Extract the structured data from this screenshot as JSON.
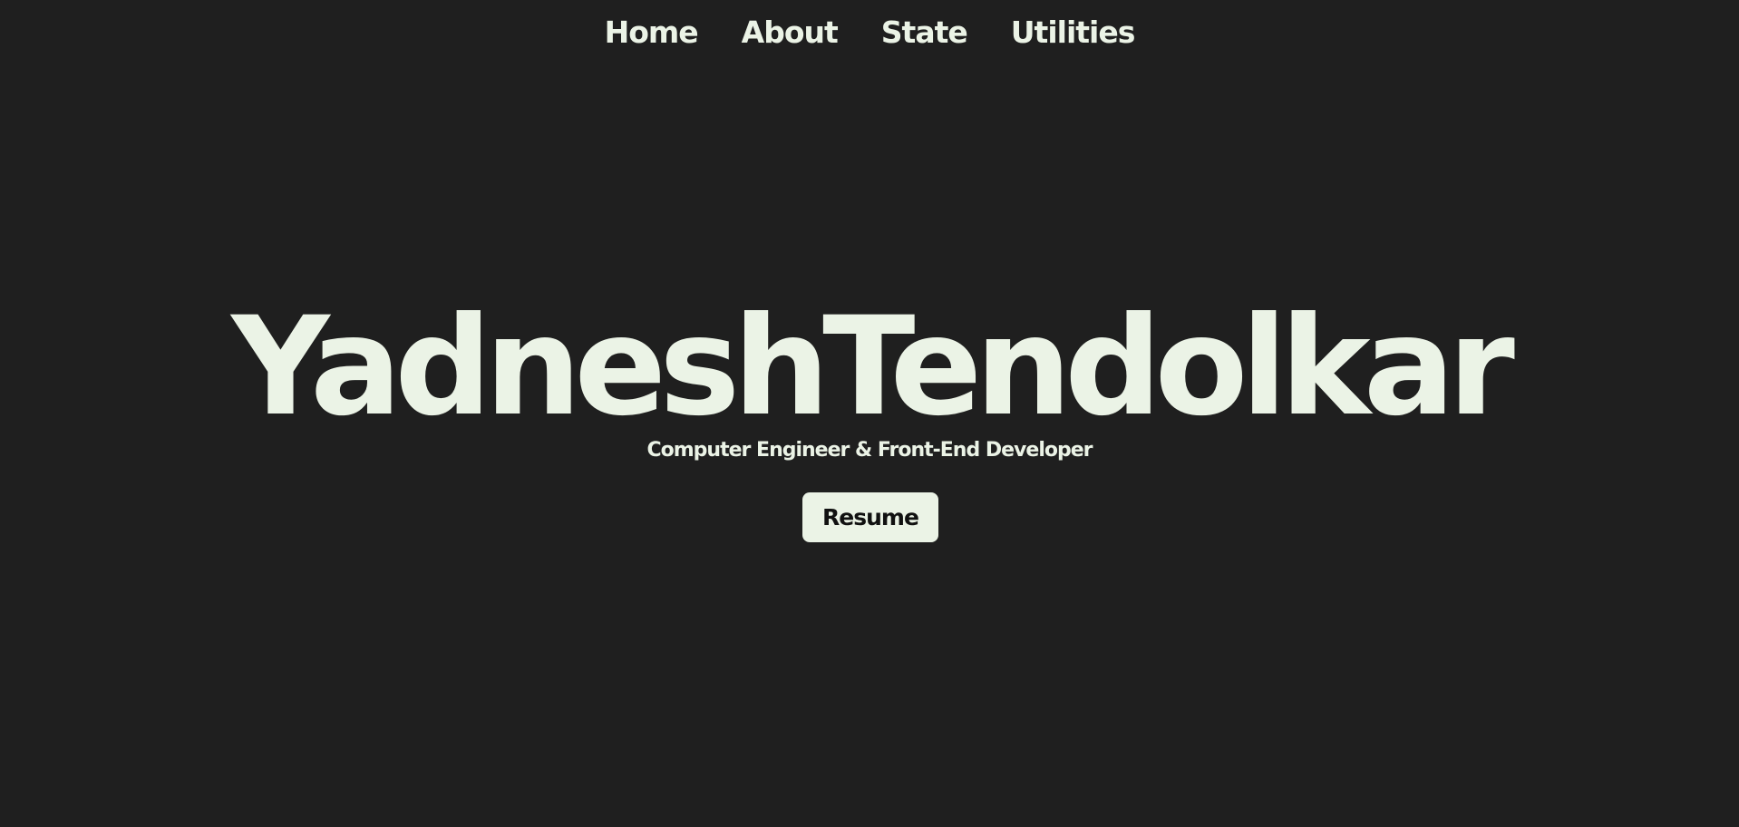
{
  "nav": {
    "items": [
      {
        "label": "Home"
      },
      {
        "label": "About"
      },
      {
        "label": "State"
      },
      {
        "label": "Utilities"
      }
    ]
  },
  "hero": {
    "name": "YadneshTendolkar",
    "subtitle": "Computer Engineer & Front-End Developer",
    "resume_label": "Resume"
  },
  "colors": {
    "background": "#1f1f1f",
    "foreground": "#ebf3e6",
    "button_text": "#111111"
  }
}
